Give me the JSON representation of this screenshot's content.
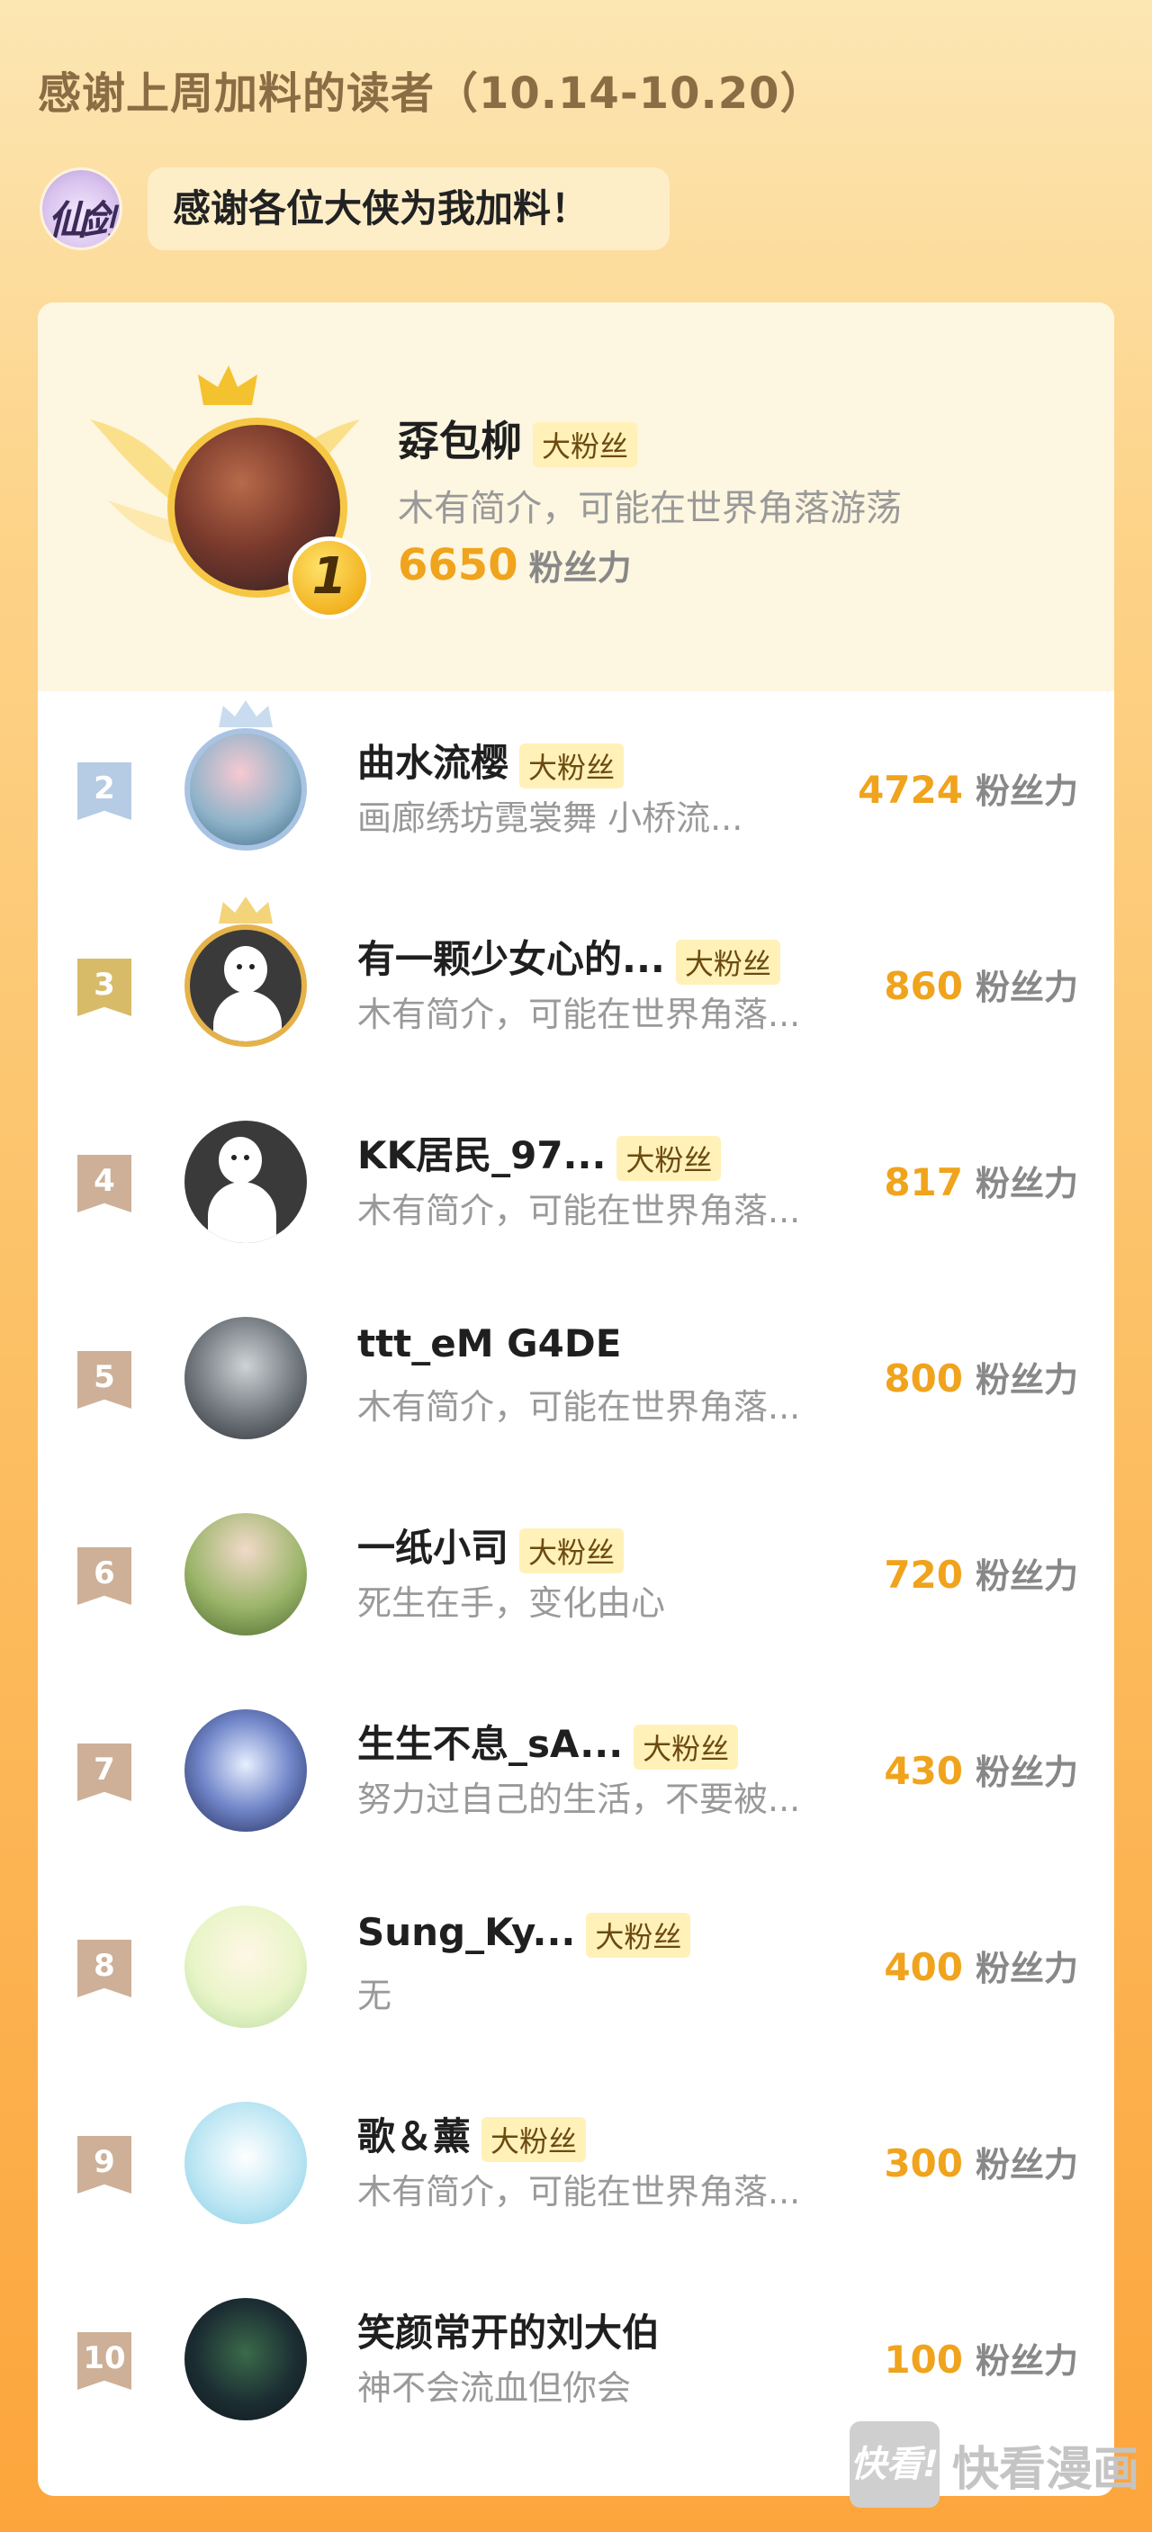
{
  "header": {
    "title": "感谢上周加料的读者（10.14-10.20）",
    "author_logo_text": "仙剑",
    "bubble_text": "感谢各位大侠为我加料！"
  },
  "badge_label": "大粉丝",
  "score_unit": "粉丝力",
  "top_reader": {
    "rank": "1",
    "name": "孬包柳",
    "bio": "木有简介，可能在世界角落游荡",
    "score": "6650"
  },
  "readers": [
    {
      "rank": "2",
      "name": "曲水流樱",
      "badge": "大粉丝",
      "bio": "画廊绣坊霓裳舞 小桥流...",
      "score": "4724"
    },
    {
      "rank": "3",
      "name": "有一颗少女心的...",
      "badge": "大粉丝",
      "bio": "木有简介，可能在世界角落...",
      "score": "860"
    },
    {
      "rank": "4",
      "name": "KK居民_97...",
      "badge": "大粉丝",
      "bio": "木有简介，可能在世界角落...",
      "score": "817"
    },
    {
      "rank": "5",
      "name": "ttt_eM G4DE",
      "badge": "",
      "bio": "木有简介，可能在世界角落...",
      "score": "800"
    },
    {
      "rank": "6",
      "name": "一纸小司",
      "badge": "大粉丝",
      "bio": "死生在手，变化由心",
      "score": "720"
    },
    {
      "rank": "7",
      "name": "生生不息_sA...",
      "badge": "大粉丝",
      "bio": "努力过自己的生活，不要被...",
      "score": "430"
    },
    {
      "rank": "8",
      "name": "Sung_Ky...",
      "badge": "大粉丝",
      "bio": "无",
      "score": "400"
    },
    {
      "rank": "9",
      "name": "歌＆薰",
      "badge": "大粉丝",
      "bio": "木有简介，可能在世界角落...",
      "score": "300"
    },
    {
      "rank": "10",
      "name": "笑颜常开的刘大伯",
      "badge": "",
      "bio": "神不会流血但你会",
      "score": "100"
    }
  ],
  "watermark": {
    "logo_text": "快看!",
    "brand_text": "快看漫画"
  },
  "colors": {
    "score": "#f0a31c",
    "badge_bg": "#fff1b8",
    "rank1_coin": "#f2b321",
    "rank2_ribbon": "#b6cbe4",
    "rank3_ribbon": "#d8bb68",
    "rank_other_ribbon": "#cdb097"
  }
}
